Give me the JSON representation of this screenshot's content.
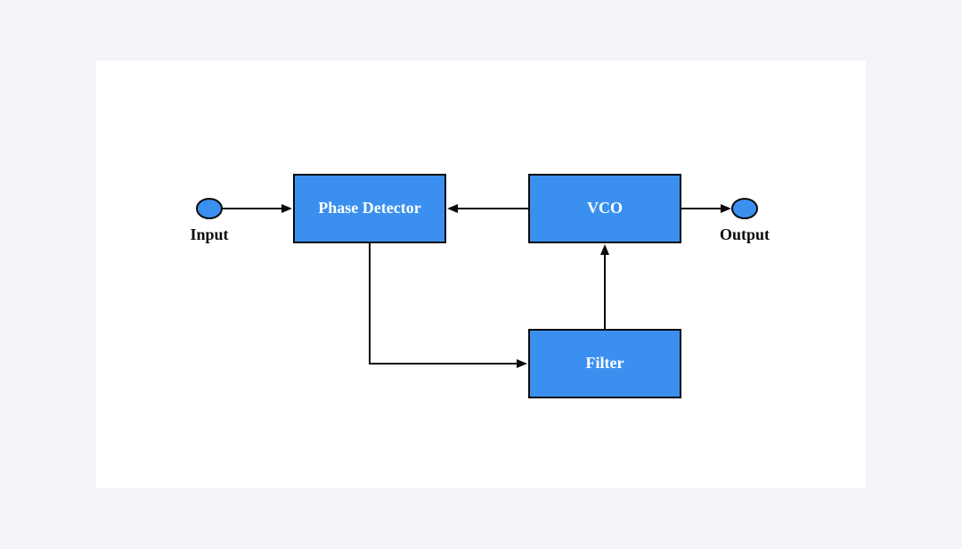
{
  "diagram": {
    "endpoints": {
      "input": {
        "label": "Input"
      },
      "output": {
        "label": "Output"
      }
    },
    "blocks": {
      "phase_detector": {
        "label": "Phase Detector"
      },
      "vco": {
        "label": "VCO"
      },
      "filter": {
        "label": "Filter"
      }
    },
    "colors": {
      "block_fill": "#3b90ef",
      "block_stroke": "#0a0a0a",
      "arrow": "#0a0a0a",
      "page_bg": "#f4f5f9",
      "card_bg": "#ffffff"
    },
    "connections": [
      {
        "from": "input",
        "to": "phase_detector",
        "direction": "right"
      },
      {
        "from": "vco",
        "to": "phase_detector",
        "direction": "left"
      },
      {
        "from": "vco",
        "to": "output",
        "direction": "right"
      },
      {
        "from": "phase_detector",
        "to": "filter",
        "direction": "down-right"
      },
      {
        "from": "filter",
        "to": "vco",
        "direction": "up"
      }
    ]
  }
}
